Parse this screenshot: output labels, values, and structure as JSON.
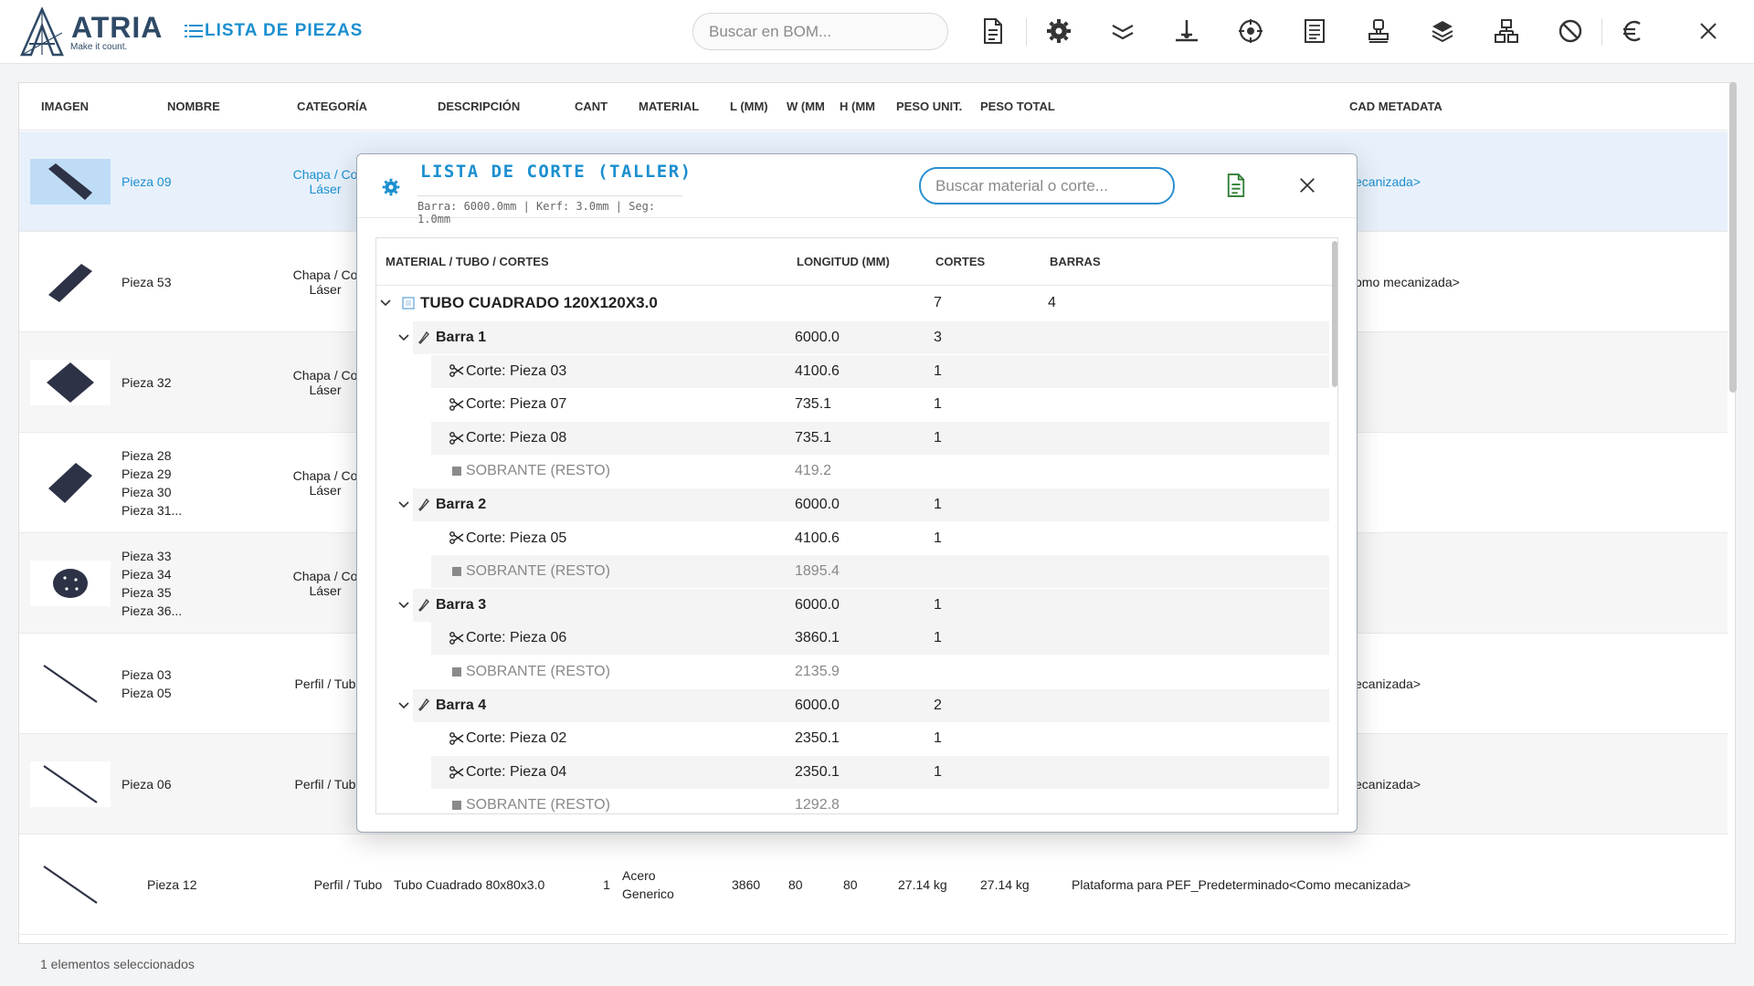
{
  "header": {
    "brand": "ATRIA",
    "tagline": "Make it count.",
    "page_title": "LISTA DE PIEZAS",
    "search_placeholder": "Buscar en BOM...",
    "toolbar_icons": [
      "document-icon",
      "gear-cog-icon",
      "chevrons-down-icon",
      "weld-icon",
      "target-icon",
      "list-document-icon",
      "stamp-icon",
      "layers-icon",
      "hierarchy-icon",
      "cancel-icon",
      "euro-icon",
      "close-icon"
    ]
  },
  "table": {
    "columns": [
      "IMAGEN",
      "NOMBRE",
      "CATEGORÍA",
      "DESCRIPCIÓN",
      "CANT",
      "MATERIAL",
      "L (MM)",
      "W (MM",
      "H (MM",
      "PESO UNIT.",
      "PESO TOTAL",
      "CAD METADATA"
    ],
    "rows": [
      {
        "names": [
          "Pieza 09"
        ],
        "category": [
          "Chapa / Co",
          "Láser"
        ],
        "metadata": "ecanizada>",
        "shape": "bar-diag",
        "selected": true
      },
      {
        "names": [
          "Pieza 53"
        ],
        "category": [
          "Chapa / Co",
          "Láser"
        ],
        "metadata": "omo mecanizada>",
        "shape": "plate"
      },
      {
        "names": [
          "Pieza 32"
        ],
        "category": [
          "Chapa / Co",
          "Láser"
        ],
        "metadata": "",
        "shape": "diamond"
      },
      {
        "names": [
          "Pieza 28",
          "Pieza 29",
          "Pieza 30",
          "Pieza 31..."
        ],
        "category": [
          "Chapa / Co",
          "Láser"
        ],
        "metadata": "",
        "shape": "plate"
      },
      {
        "names": [
          "Pieza 33",
          "Pieza 34",
          "Pieza 35",
          "Pieza 36..."
        ],
        "category": [
          "Chapa / Co",
          "Láser"
        ],
        "metadata": "",
        "shape": "disc"
      },
      {
        "names": [
          "Pieza 03",
          "Pieza 05"
        ],
        "category": [
          "Perfil / Tub"
        ],
        "metadata": "ecanizada>",
        "shape": "line"
      },
      {
        "names": [
          "Pieza 06"
        ],
        "category": [
          "Perfil / Tub"
        ],
        "metadata": "ecanizada>",
        "shape": "line"
      },
      {
        "names": [
          "Pieza 12"
        ],
        "category": [
          "Perfil / Tubo"
        ],
        "description": "Tubo Cuadrado 80x80x3.0",
        "qty": "1",
        "material": [
          "Acero",
          "Generico"
        ],
        "l": "3860",
        "w": "80",
        "h": "80",
        "unit_weight": "27.14 kg",
        "total_weight": "27.14 kg",
        "metadata": "Plataforma para PEF_Predeterminado<Como mecanizada>",
        "shape": "line"
      }
    ]
  },
  "status": "1 elementos seleccionados",
  "modal": {
    "title": "LISTA DE CORTE (TALLER)",
    "subtitle": "Barra: 6000.0mm | Kerf: 3.0mm | Seg: 1.0mm",
    "search_placeholder": "Buscar material o corte...",
    "columns": [
      "MATERIAL / TUBO / CORTES",
      "LONGITUD (MM)",
      "CORTES",
      "BARRAS"
    ],
    "tree": [
      {
        "level": 0,
        "label": "TUBO CUADRADO 120X120X3.0",
        "length": "",
        "cuts": "7",
        "bars": "4"
      },
      {
        "level": 1,
        "label": "Barra 1",
        "length": "6000.0",
        "cuts": "3"
      },
      {
        "level": 2,
        "label": "Corte: Pieza 03",
        "length": "4100.6",
        "cuts": "1"
      },
      {
        "level": 2,
        "label": "Corte: Pieza 07",
        "length": "735.1",
        "cuts": "1"
      },
      {
        "level": 2,
        "label": "Corte: Pieza 08",
        "length": "735.1",
        "cuts": "1"
      },
      {
        "level": 3,
        "label": "SOBRANTE (RESTO)",
        "length": "419.2",
        "cuts": ""
      },
      {
        "level": 1,
        "label": "Barra 2",
        "length": "6000.0",
        "cuts": "1"
      },
      {
        "level": 2,
        "label": "Corte: Pieza 05",
        "length": "4100.6",
        "cuts": "1"
      },
      {
        "level": 3,
        "label": "SOBRANTE (RESTO)",
        "length": "1895.4",
        "cuts": ""
      },
      {
        "level": 1,
        "label": "Barra 3",
        "length": "6000.0",
        "cuts": "1"
      },
      {
        "level": 2,
        "label": "Corte: Pieza 06",
        "length": "3860.1",
        "cuts": "1"
      },
      {
        "level": 3,
        "label": "SOBRANTE (RESTO)",
        "length": "2135.9",
        "cuts": ""
      },
      {
        "level": 1,
        "label": "Barra 4",
        "length": "6000.0",
        "cuts": "2"
      },
      {
        "level": 2,
        "label": "Corte: Pieza 02",
        "length": "2350.1",
        "cuts": "1"
      },
      {
        "level": 2,
        "label": "Corte: Pieza 04",
        "length": "2350.1",
        "cuts": "1"
      },
      {
        "level": 3,
        "label": "SOBRANTE (RESTO)",
        "length": "1292.8",
        "cuts": ""
      }
    ]
  },
  "colors": {
    "accent": "#1b8fd0",
    "brand": "#2f4a66",
    "shape": "#2d3246",
    "selected_row": "#e8f1fb"
  }
}
